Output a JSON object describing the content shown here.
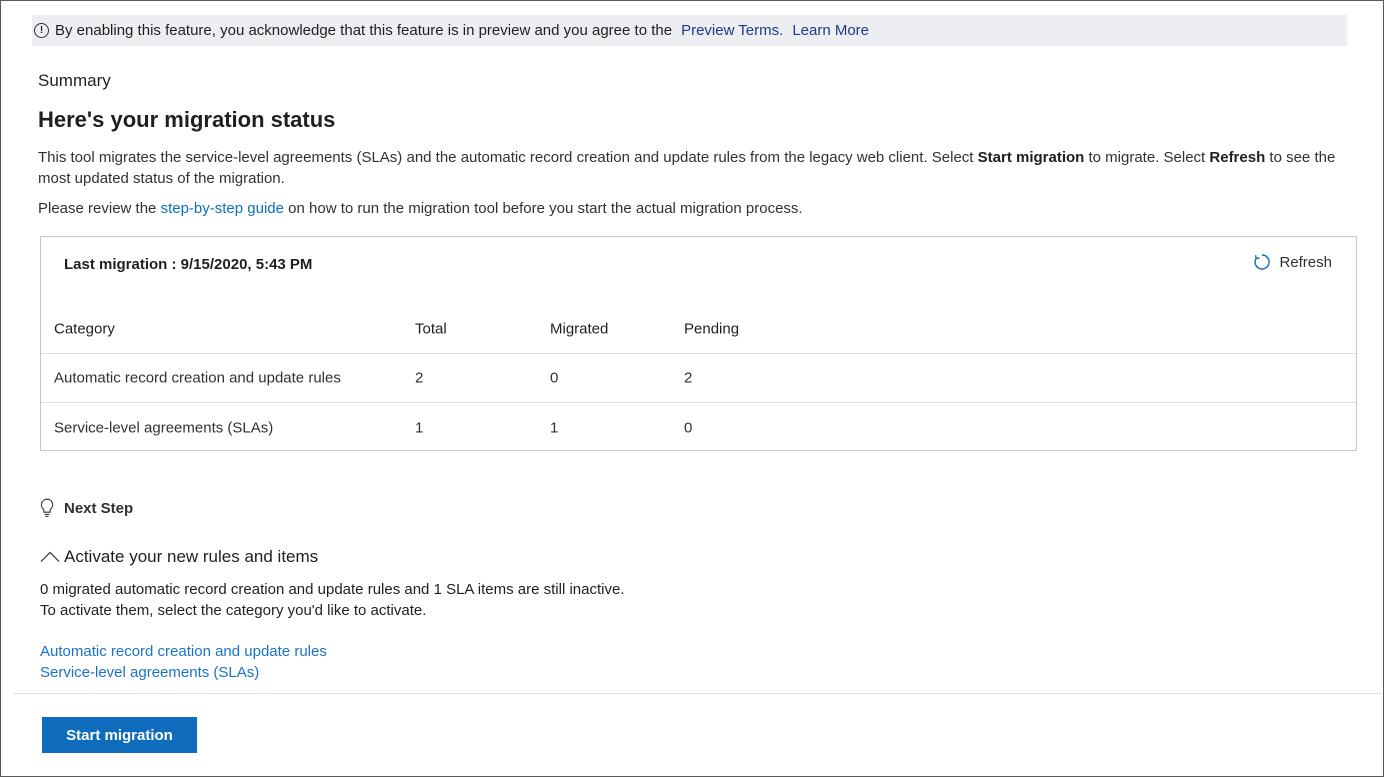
{
  "banner": {
    "icon": "info-icon",
    "text": "By enabling this feature, you acknowledge that this feature is in preview and you agree to the",
    "preview_terms_link": "Preview Terms.",
    "learn_more_link": "Learn More"
  },
  "summary_label": "Summary",
  "page_title": "Here's your migration status",
  "description": {
    "part1": "This tool migrates the service-level agreements (SLAs) and the automatic record creation and update rules from the legacy web client. Select ",
    "bold1": "Start migration",
    "part2": " to migrate. Select ",
    "bold2": "Refresh",
    "part3": " to see the most updated status of the migration."
  },
  "review": {
    "prefix": "Please review the ",
    "link": "step-by-step guide",
    "suffix": " on how to run the migration tool before you start the actual migration process."
  },
  "status_card": {
    "last_migration": "Last migration : 9/15/2020, 5:43 PM",
    "refresh_label": "Refresh",
    "refresh_icon": "refresh-icon",
    "columns": [
      "Category",
      "Total",
      "Migrated",
      "Pending"
    ],
    "rows": [
      [
        "Automatic record creation and update rules",
        "2",
        "0",
        "2"
      ],
      [
        "Service-level agreements (SLAs)",
        "1",
        "1",
        "0"
      ]
    ]
  },
  "next_step": {
    "icon": "lightbulb-icon",
    "label": "Next Step"
  },
  "activate": {
    "icon": "chevron-up-icon",
    "heading": "Activate your new rules and items",
    "line1": "0 migrated automatic record creation and update rules and 1 SLA items are still inactive.",
    "line2": "To activate them, select the category you'd like to activate.",
    "links": [
      "Automatic record creation and update rules",
      "Service-level agreements (SLAs)"
    ]
  },
  "footer": {
    "start_button": "Start migration"
  },
  "colors": {
    "banner_bg": "#edeef1",
    "link": "#106ebe",
    "primary": "#0f6cbd",
    "border": "#c8c6c4"
  }
}
